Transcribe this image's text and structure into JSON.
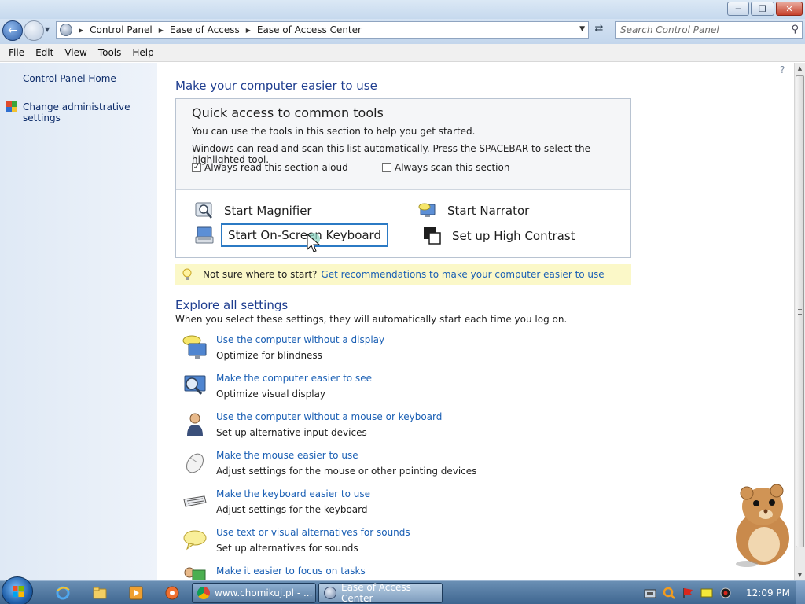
{
  "window": {
    "minimize_label": "▭",
    "maximize_label": "❐",
    "close_label": "✕"
  },
  "address": {
    "breadcrumbs": [
      "Control Panel",
      "Ease of Access",
      "Ease of Access Center"
    ],
    "search_placeholder": "Search Control Panel"
  },
  "menu": [
    "File",
    "Edit",
    "View",
    "Tools",
    "Help"
  ],
  "sidebar": {
    "home": "Control Panel Home",
    "admin": "Change administrative settings"
  },
  "main": {
    "title": "Make your computer easier to use",
    "quick": {
      "title": "Quick access to common tools",
      "desc1": "You can use the tools in this section to help you get started.",
      "desc2": "Windows can read and scan this list automatically.  Press the SPACEBAR to select the highlighted tool.",
      "read_aloud": {
        "label": "Always read this section aloud",
        "checked": true
      },
      "scan": {
        "label": "Always scan this section",
        "checked": false
      },
      "tools": {
        "magnifier": "Start Magnifier",
        "narrator": "Start Narrator",
        "osk": "Start On-Screen Keyboard",
        "contrast": "Set up High Contrast"
      }
    },
    "tip": {
      "text": "Not sure where to start?",
      "link": "Get recommendations to make your computer easier to use"
    },
    "explore": {
      "title": "Explore all settings",
      "desc": "When you select these settings, they will automatically start each time you log on.",
      "items": [
        {
          "icon": "display-speech-icon",
          "link": "Use the computer without a display",
          "desc": "Optimize for blindness"
        },
        {
          "icon": "monitor-magnify-icon",
          "link": "Make the computer easier to see",
          "desc": "Optimize visual display"
        },
        {
          "icon": "person-icon",
          "link": "Use the computer without a mouse or keyboard",
          "desc": "Set up alternative input devices"
        },
        {
          "icon": "mouse-icon",
          "link": "Make the mouse easier to use",
          "desc": "Adjust settings for the mouse or other pointing devices"
        },
        {
          "icon": "keyboard-icon",
          "link": "Make the keyboard easier to use",
          "desc": "Adjust settings for the keyboard"
        },
        {
          "icon": "speech-bubble-icon",
          "link": "Use text or visual alternatives for sounds",
          "desc": "Set up alternatives for sounds"
        },
        {
          "icon": "focus-icon",
          "link": "Make it easier to focus on tasks",
          "desc": ""
        }
      ]
    }
  },
  "taskbar": {
    "chrome_label": "www.chomikuj.pl - ...",
    "ease_label": "Ease of Access Center",
    "clock": "12:09 PM"
  },
  "colors": {
    "link": "#1a5fb4",
    "heading": "#1e3d8f",
    "tip_background": "#fbf8c8",
    "focus_border": "#2b7ac4"
  }
}
